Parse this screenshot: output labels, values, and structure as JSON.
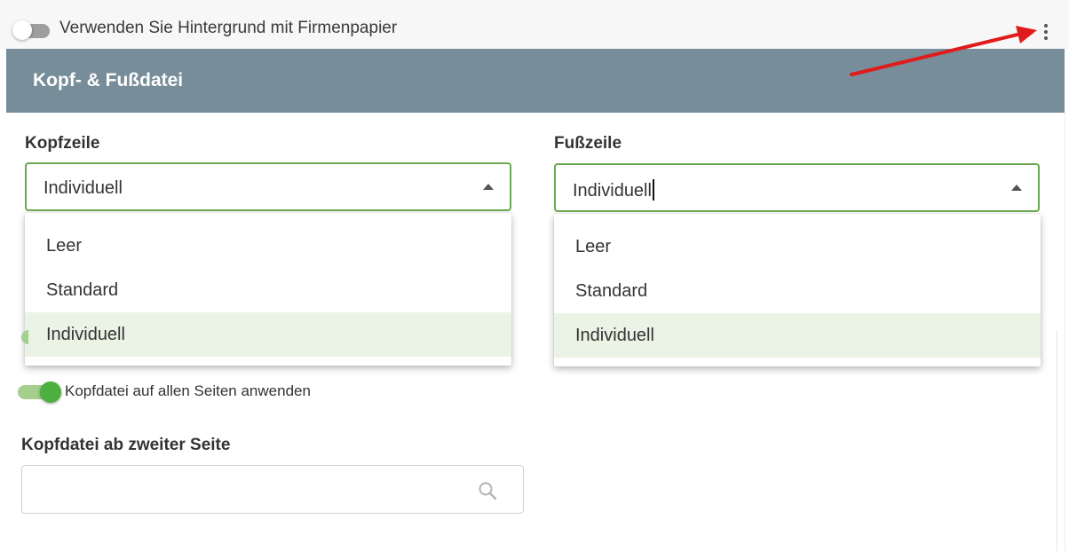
{
  "top_bar": {
    "background_toggle": {
      "label": "Verwenden Sie Hintergrund mit Firmenpapier",
      "checked": false
    },
    "menu_icon": "more-vertical-icon"
  },
  "card": {
    "title": "Kopf- & Fußdatei",
    "header_color": "#778d9a"
  },
  "header_field": {
    "label": "Kopfzeile",
    "value": "Individuell",
    "options": [
      "Leer",
      "Standard",
      "Individuell"
    ],
    "selected_option": "Individuell"
  },
  "footer_field": {
    "label": "Fußzeile",
    "value": "Individuell",
    "options": [
      "Leer",
      "Standard",
      "Individuell"
    ],
    "selected_option": "Individuell"
  },
  "apply_all_toggle": {
    "label": "Kopfdatei auf allen Seiten anwenden",
    "checked": true
  },
  "second_page_field": {
    "label": "Kopfdatei ab zweiter Seite",
    "value": "",
    "icon": "search-icon"
  },
  "annotation": {
    "arrow_color": "#e01b1b"
  },
  "colors": {
    "accent_green": "#4caf3f",
    "border_green": "#6aa84f",
    "selected_option_bg": "#eaf3e4"
  }
}
